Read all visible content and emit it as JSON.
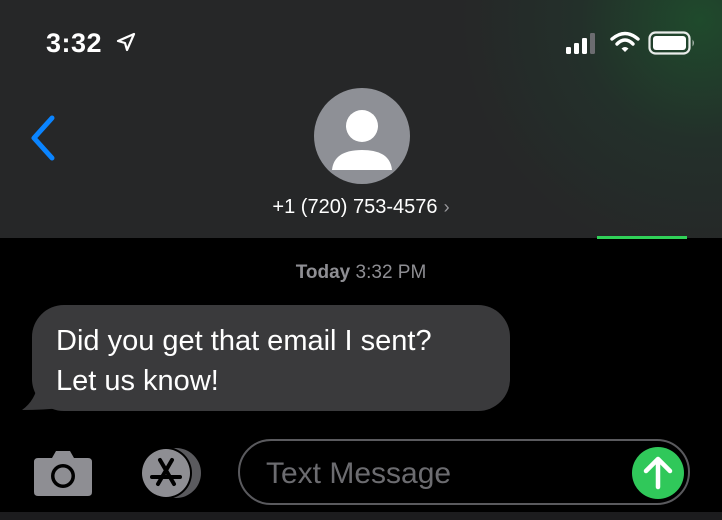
{
  "status_bar": {
    "time": "3:32",
    "location_icon": "location-arrow-icon",
    "signal_icon": "cellular-signal-icon",
    "wifi_icon": "wifi-icon",
    "battery_icon": "battery-icon"
  },
  "header": {
    "back_icon": "chevron-left-icon",
    "avatar_icon": "person-silhouette-icon",
    "contact_name": "+1 (720) 753-4576",
    "contact_chevron": "›",
    "accent_color": "#30d158"
  },
  "conversation": {
    "timestamp_day": "Today",
    "timestamp_time": "3:32 PM",
    "messages": [
      {
        "direction": "incoming",
        "lines": [
          "Did you get that email I sent?",
          "Let us know!"
        ]
      }
    ]
  },
  "composer": {
    "camera_icon": "camera-icon",
    "appstore_icon": "app-store-icon",
    "placeholder": "Text Message",
    "value": "",
    "send_icon": "arrow-up-icon",
    "send_color": "#30c85a"
  }
}
